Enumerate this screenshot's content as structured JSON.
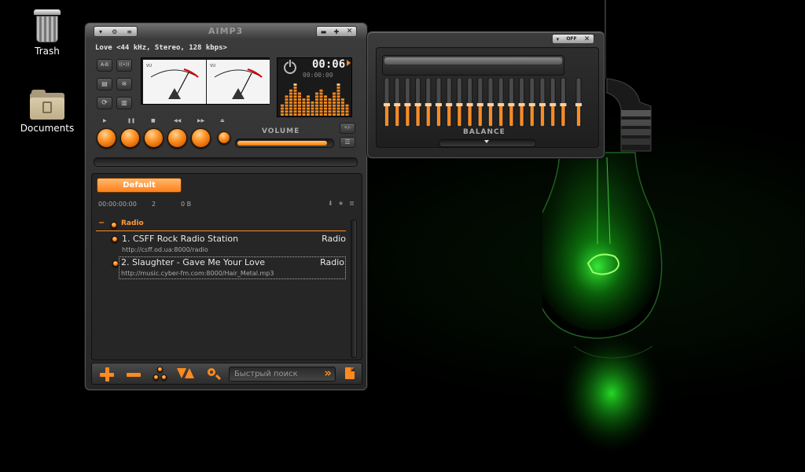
{
  "desktop": {
    "icons": [
      {
        "label": "Trash"
      },
      {
        "label": "Documents"
      }
    ]
  },
  "player": {
    "logo": "AIMP3",
    "title_buttons": [
      "▾",
      "⚙",
      "≡"
    ],
    "win_buttons": [
      "▬",
      "✚",
      "✕"
    ],
    "track_info": "Love <44 kHz, Stereo, 128 kbps>",
    "time_display": "00:06",
    "time_remaining": "00:00:00",
    "vu_scale_left": "VU",
    "vu_scale_right": "VU",
    "side_buttons": [
      "A-B",
      "((•))",
      "▤",
      "≋",
      "⟳",
      "▥"
    ],
    "transport_symbols": [
      "▶",
      "❚❚",
      "■",
      "◀◀",
      "▶▶",
      "⏏"
    ],
    "volume_label": "VOLUME",
    "volume_level": 0.95,
    "spectrum_levels": [
      0.35,
      0.55,
      0.78,
      0.92,
      0.68,
      0.5,
      0.6,
      0.42,
      0.64,
      0.75,
      0.58,
      0.47,
      0.7,
      0.88,
      0.52,
      0.3
    ],
    "colors": {
      "accent": "#ff8a1f",
      "display_bg": "#1b1b1b",
      "text_orange": "#ff9a3a"
    }
  },
  "playlist": {
    "tab": "Default",
    "summary": {
      "duration": "00:00:00:00",
      "count": "2",
      "size": "0 B"
    },
    "group": {
      "collapse": "−",
      "name": "Radio"
    },
    "items": [
      {
        "title": "1. CSFF Rock Radio Station",
        "url": "http://csff.od.ua:8000/radio",
        "tag": "Radio"
      },
      {
        "title": "2. Slaughter - Gave Me Your Love",
        "url": "http://music.cyber-fm.com:8000/Hair_Metal.mp3",
        "tag": "Radio"
      }
    ],
    "footer": {
      "search_placeholder": "Быстрый поиск",
      "search_go": "»"
    }
  },
  "equalizer": {
    "win_buttons": [
      "▾",
      "OFF",
      "✕"
    ],
    "balance_label": "BALANCE",
    "band_levels": [
      0.45,
      0.45,
      0.45,
      0.45,
      0.45,
      0.45,
      0.45,
      0.45,
      0.45,
      0.45,
      0.45,
      0.45,
      0.45,
      0.45,
      0.45,
      0.45,
      0.45,
      0.45
    ],
    "preamp_level": 0.45
  }
}
